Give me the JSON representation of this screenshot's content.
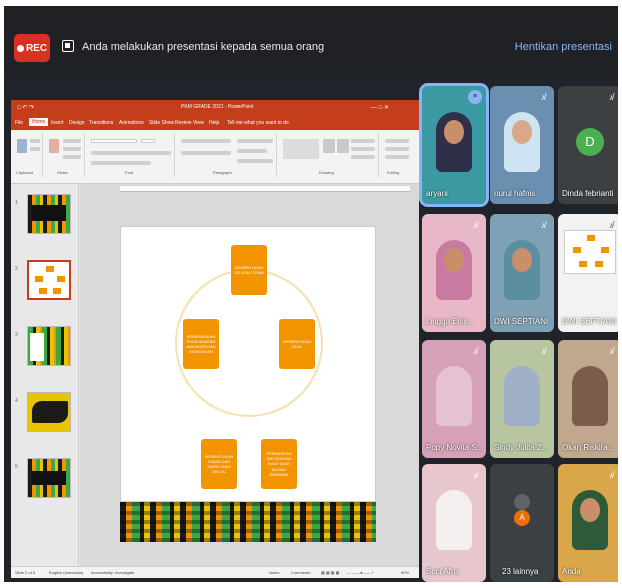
{
  "topbar": {
    "rec_label": "REC",
    "presenting_text": "Anda melakukan presentasi kepada semua orang",
    "stop_label": "Hentikan presentasi"
  },
  "powerpoint": {
    "title": "PKM GRADE 2021 - PowerPoint",
    "tabs": [
      "File",
      "Home",
      "Insert",
      "Design",
      "Transitions",
      "Animations",
      "Slide Show",
      "Review",
      "View",
      "Help",
      "Tell me what you want to do"
    ],
    "ribbon_groups": [
      "Clipboard",
      "Slides",
      "Font",
      "Paragraph",
      "Drawing",
      "Editing"
    ],
    "slide_numbers": [
      "1",
      "2",
      "3",
      "4",
      "5"
    ],
    "status_slide": "Slide 2 of 5",
    "status_language": "English (Indonesia)",
    "status_accessibility": "Accessibility: Investigate",
    "status_notes": "Notes",
    "status_comments": "Comments",
    "zoom": "50%",
    "slide_boxes": [
      "MENENTUKAN IDE ATAU TEMA",
      "MENENTUKAN GOAL",
      "PERHATIKAN IDE DENGAN KATA YANG MUDAH DIPAHAMI",
      "MENENTUKAN SISWA DAN SIAPA YANG DITUJU",
      "KEMBANGKAN PUISI DENGAN IMAJINASI DAN KEINDAHAN"
    ]
  },
  "participants": [
    {
      "name": "aryani",
      "state": "speaking",
      "color": "#3aa0a8"
    },
    {
      "name": "nurul hafnis",
      "state": "muted",
      "color": "#6b8fb0"
    },
    {
      "name": "Dinda febrianti",
      "state": "muted",
      "initial": "D",
      "avatar_color": "#4caf50"
    },
    {
      "name": "Lingga Elvir...",
      "state": "muted",
      "color": "#e9b8c8"
    },
    {
      "name": "DWI SEPTIANI",
      "state": "muted",
      "color": "#7fa1b5"
    },
    {
      "name": "DWI SEPTIANI",
      "state": "muted",
      "color": "#f2f2f2"
    },
    {
      "name": "Popy Novita S...",
      "state": "muted",
      "color": "#d6a0b8"
    },
    {
      "name": "Sindy Julita Z...",
      "state": "muted",
      "color": "#b7c5a0"
    },
    {
      "name": "Okan Riskira...",
      "state": "muted",
      "color": "#c2a78f"
    },
    {
      "name": "Suci Afra",
      "state": "muted",
      "color": "#e7c7cc"
    },
    {
      "name": "23 lainnya",
      "state": "more",
      "initial": "A"
    },
    {
      "name": "Anda",
      "state": "muted",
      "color": "#d9a64a"
    }
  ]
}
